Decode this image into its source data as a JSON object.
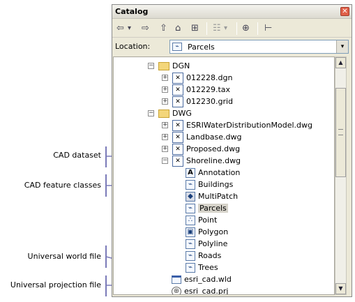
{
  "window": {
    "title": "Catalog",
    "close_symbol": "✕"
  },
  "toolbar": {
    "back_icon": "⇦",
    "back_dropdown": "▾",
    "forward_icon": "⇨",
    "up_icon": "⇧",
    "home_icon": "⌂",
    "connect_icon": "⊞",
    "view_icon": "☷",
    "view_dropdown": "▾",
    "add_folder_icon": "⊕",
    "tree_icon": "⊢"
  },
  "location": {
    "label": "Location:",
    "value": "Parcels",
    "dropdown_symbol": "▾"
  },
  "tree": {
    "collapse_symbol": "−",
    "expand_symbol": "+",
    "dgn_folder": "DGN",
    "dgn_files": [
      "012228.dgn",
      "012229.tax",
      "012230.grid"
    ],
    "dwg_folder": "DWG",
    "dwg_files": [
      "ESRIWaterDistributionModel.dwg",
      "Landbase.dwg",
      "Proposed.dwg",
      "Shoreline.dwg"
    ],
    "feature_classes": [
      "Annotation",
      "Buildings",
      "MultiPatch",
      "Parcels",
      "Point",
      "Polygon",
      "Polyline",
      "Roads",
      "Trees"
    ],
    "world_file": "esri_cad.wld",
    "projection_file": "esri_cad.prj"
  },
  "annotations": {
    "cad_dataset": "CAD dataset",
    "cad_feature_classes": "CAD feature classes",
    "universal_world_file": "Universal world file",
    "universal_projection_file": "Universal projection file"
  },
  "scrollbar": {
    "up_symbol": "▲",
    "down_symbol": "▼"
  }
}
